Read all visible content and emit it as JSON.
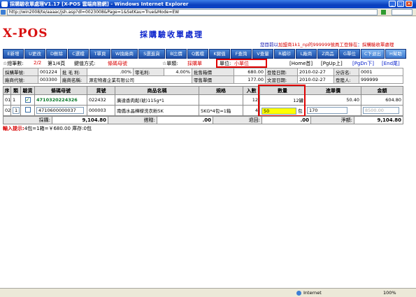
{
  "window": {
    "title": "採購驗收單處理V1.17 [X-POS 雲端商務網] - Windows Internet Explorer",
    "address": "http://win2008/te/aaaac/jsh.asp?dl=0023008&Page=1&SetKau=True&Mode=EW"
  },
  "header": {
    "logo": "X-POS",
    "page_title": "採購驗收單處理",
    "user_prefix": "您目前以",
    "user_account": "加盟商1k1_np的999999號員工登錄在",
    "user_suffix": "：",
    "current_module": "採購驗收單處理"
  },
  "toolbar": [
    {
      "label": "E新增",
      "name": "add-button"
    },
    {
      "label": "U更改",
      "name": "update-button"
    },
    {
      "label": "D刪除",
      "name": "delete-button"
    },
    {
      "label": "C選檔",
      "name": "select-file-button"
    },
    {
      "label": "T單頁",
      "name": "single-page-button"
    },
    {
      "label": "W換廠商",
      "name": "change-vendor-button"
    },
    {
      "label": "S選進貨",
      "name": "select-purchase-button"
    },
    {
      "label": "B比價",
      "name": "compare-price-button"
    },
    {
      "label": "Q舊檔",
      "name": "old-file-button"
    },
    {
      "label": "K鍵值",
      "name": "key-value-button"
    },
    {
      "label": "F查詢",
      "name": "query-button"
    },
    {
      "label": "V查量",
      "name": "check-qty-button"
    },
    {
      "label": "R補印",
      "name": "reprint-button"
    },
    {
      "label": "L廠商",
      "name": "vendor-button"
    },
    {
      "label": "Z商品",
      "name": "product-button"
    },
    {
      "label": "G單位",
      "name": "unit-button"
    },
    {
      "label": "C下退出",
      "name": "exit-button"
    },
    {
      "label": "H幫助",
      "name": "help-button"
    }
  ],
  "info": {
    "total_label": "☆總筆數:",
    "total_value": "2/2",
    "page_label": "第1/4頁",
    "key_label": "鍵值方式:",
    "key_value": "條碼母號",
    "unit_label": "☆單類:",
    "unit_value": "採購單",
    "measure_label": "單位:",
    "measure_value": "小單位",
    "nav_home": "[Home首]",
    "nav_pgup": "[PgUp上]",
    "nav_pgdn": "[PgDn下]",
    "nav_end": "[End尾]"
  },
  "form": {
    "row1": {
      "order_no_label": "採購單號:",
      "order_no": "001224",
      "gross_label": "批 毛 利:",
      "gross": ".00%",
      "retail_gross_label": "零毛利:",
      "retail_gross": "4.00%",
      "wholesale_price_label": "批售箱價",
      "wholesale_price": "680.00",
      "reg_date_label": "登陸日期:",
      "reg_date": "2010-02-27",
      "branch_label": "分店名:",
      "branch": "0001"
    },
    "row2": {
      "vendor_code_label": "廠商代號:",
      "vendor_code": "003300",
      "vendor_name_label": "廠商名稱:",
      "vendor_name": "源宏物產企業有限公司",
      "retail_price_label": "零售單價",
      "retail_price": "177.00",
      "doc_date_label": "文習日期:",
      "doc_date": "2010-02-27",
      "reg_person_label": "登陸人:",
      "reg_person": "999999"
    }
  },
  "grid": {
    "headers": [
      "序",
      "類",
      "驗貨",
      "條碼母號",
      "貨號",
      "商品名稱",
      "規格",
      "入數",
      "數量",
      "進單價",
      "金額"
    ],
    "rows": [
      {
        "seq": "01",
        "type": "1",
        "check": "✓",
        "barcode": "4710320224326",
        "item_no": "022432",
        "name": "廣達香肉鬆(琥)115g*1",
        "spec": "",
        "pack": "12",
        "qty": "12罐",
        "price": "50.40",
        "amount": "604.80"
      },
      {
        "seq": "02",
        "type": "1",
        "check": "",
        "barcode": "4710600000037",
        "item_no": "000003",
        "name": "南僑水晶樺檬洗衣粉5K",
        "spec": "5KG*4包=1箱",
        "pack": "4",
        "qty": "50",
        "qty_unit": "包",
        "price": "170",
        "amount": "8500.00"
      }
    ]
  },
  "totals": {
    "purchase_label": "採購:",
    "purchase": "9,104.80",
    "adjust_label": "搭贈:",
    "adjust": ".00",
    "return_label": "退回:",
    "return": ".00",
    "net_label": "淨額:",
    "net": "9,104.80"
  },
  "tip": {
    "label": "輸入提示:",
    "text": "4包=1箱=￥680.00 庫存:0包"
  },
  "statusbar": {
    "zone": "Internet",
    "zoom": "100%"
  }
}
